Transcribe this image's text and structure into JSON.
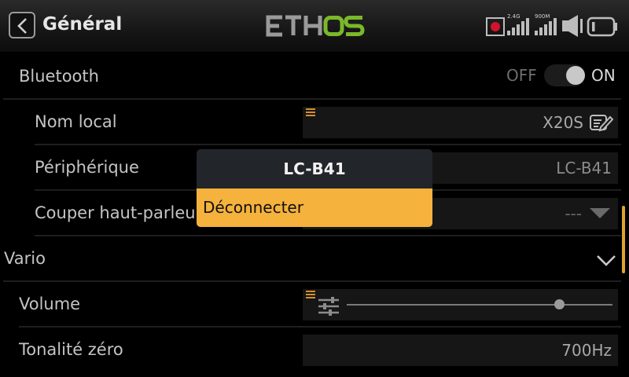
{
  "header": {
    "title": "Général",
    "brand": "ETHOS"
  },
  "status": {
    "band1": "2.4G",
    "band2": "900M"
  },
  "bluetooth": {
    "label": "Bluetooth",
    "off": "OFF",
    "on": "ON",
    "enabled": true
  },
  "nom_local": {
    "label": "Nom local",
    "value": "X20S"
  },
  "peripherique": {
    "label": "Périphérique",
    "value": "LC-B41"
  },
  "couper": {
    "label": "Couper haut-parleur",
    "value": "---"
  },
  "vario": {
    "label": "Vario"
  },
  "volume": {
    "label": "Volume",
    "level": 0.8
  },
  "tonalite": {
    "label": "Tonalité zéro",
    "value": "700Hz"
  },
  "popup": {
    "title": "LC-B41",
    "item": "Déconnecter"
  },
  "colors": {
    "accent": "#f5b23c",
    "logo_green": "#7ab929",
    "record_red": "#d0142b"
  }
}
